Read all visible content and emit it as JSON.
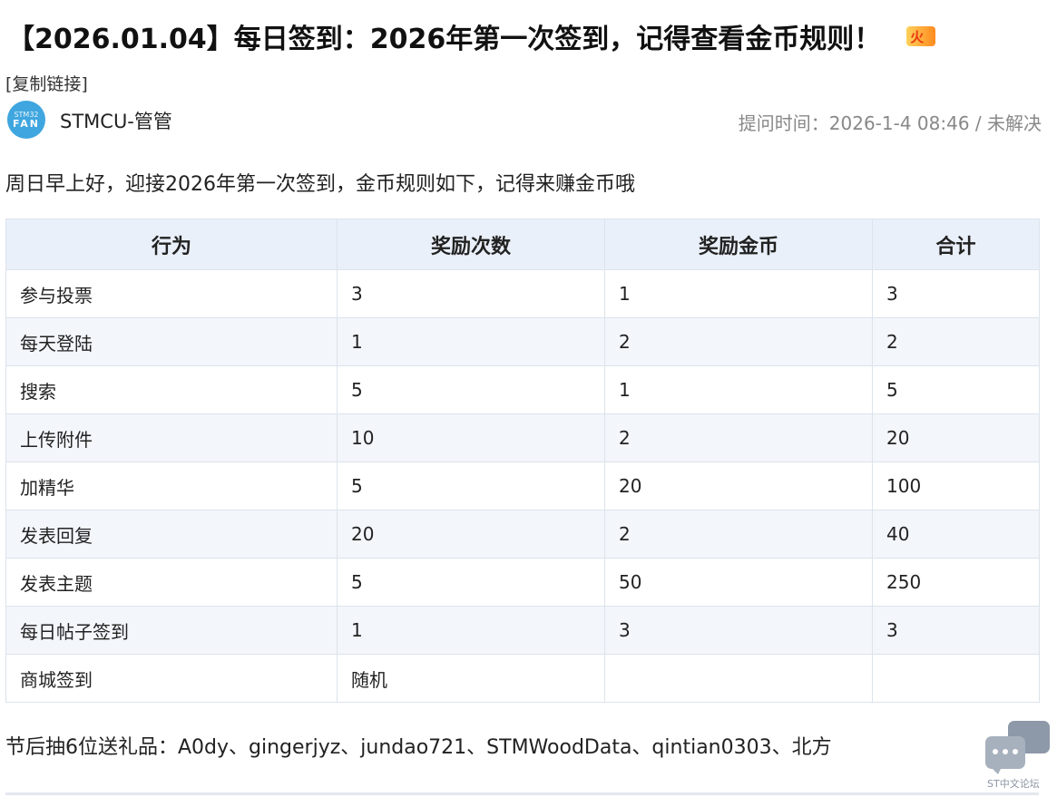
{
  "post": {
    "title": "【2026.01.04】每日签到：2026年第一次签到，记得查看金币规则！",
    "hot_badge": "火",
    "copy_link": "[复制链接]",
    "author": "STMCU-管管",
    "avatar_text_top": "STM32",
    "avatar_text_bottom": "FAN",
    "meta": "提问时间：2026-1-4 08:46 / 未解决",
    "intro": "周日早上好，迎接2026年第一次签到，金币规则如下，记得来赚金币哦",
    "gift_line": "节后抽6位送礼品：A0dy、gingerjyz、jundao721、STMWoodData、qintian0303、北方"
  },
  "table": {
    "headers": [
      "行为",
      "奖励次数",
      "奖励金币",
      "合计"
    ],
    "rows": [
      [
        "参与投票",
        "3",
        "1",
        "3"
      ],
      [
        "每天登陆",
        "1",
        "2",
        "2"
      ],
      [
        "搜索",
        "5",
        "1",
        "5"
      ],
      [
        "上传附件",
        "10",
        "2",
        "20"
      ],
      [
        "加精华",
        "5",
        "20",
        "100"
      ],
      [
        "发表回复",
        "20",
        "2",
        "40"
      ],
      [
        "发表主题",
        "5",
        "50",
        "250"
      ],
      [
        "每日帖子签到",
        "1",
        "3",
        "3"
      ],
      [
        "商城签到",
        "随机",
        "",
        ""
      ]
    ]
  },
  "float_button": {
    "label": "ST中文论坛",
    "icon": "chat-bubbles-icon"
  },
  "colors": {
    "header_bg": "#eaf0f9",
    "stripe_bg": "#f3f6fb",
    "border": "#dde3ec",
    "avatar": "#3fa6df",
    "meta_text": "#888888"
  }
}
